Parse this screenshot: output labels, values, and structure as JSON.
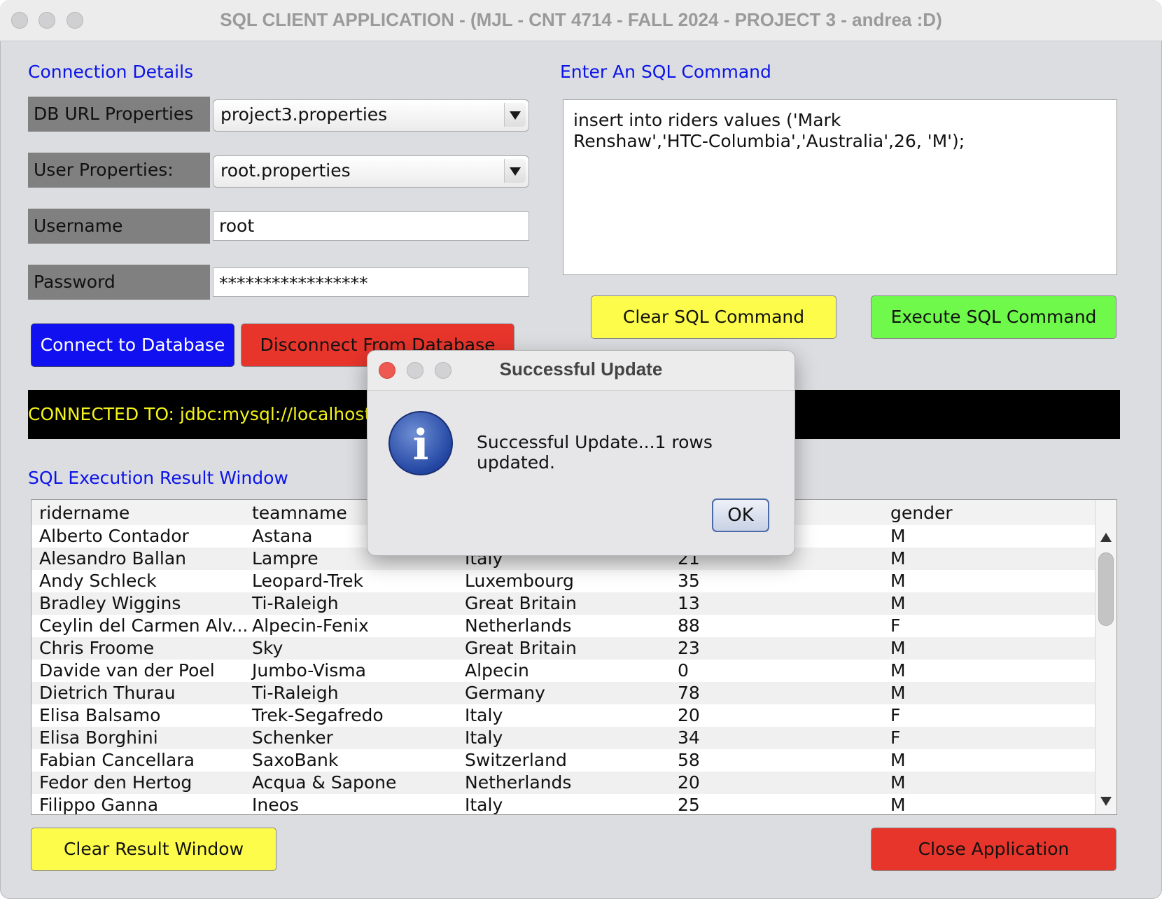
{
  "window": {
    "title": "SQL CLIENT APPLICATION - (MJL - CNT 4714 - FALL 2024 - PROJECT 3 - andrea :D)"
  },
  "connection": {
    "section_label": "Connection Details",
    "db_url_label": "DB URL Properties",
    "db_url_value": "project3.properties",
    "user_props_label": "User Properties:",
    "user_props_value": "root.properties",
    "username_label": "Username",
    "username_value": "root",
    "password_label": "Password",
    "password_value": "*****************",
    "connect_button": "Connect to Database",
    "disconnect_button": "Disconnect From Database",
    "status_text": "CONNECTED TO: jdbc:mysql://localhost:3"
  },
  "sql": {
    "section_label": "Enter An SQL Command",
    "command_text": "insert into riders values ('Mark\nRenshaw','HTC-Columbia','Australia',26, 'M');",
    "clear_button": "Clear SQL Command",
    "execute_button": "Execute SQL Command"
  },
  "results": {
    "section_label": "SQL Execution Result Window",
    "columns": [
      "ridername",
      "teamname",
      "",
      "",
      "gender"
    ],
    "rows": [
      [
        "Alberto Contador",
        "Astana",
        "",
        "",
        "M"
      ],
      [
        "Alesandro Ballan",
        "Lampre",
        "Italy",
        "21",
        "M"
      ],
      [
        "Andy Schleck",
        "Leopard-Trek",
        "Luxembourg",
        "35",
        "M"
      ],
      [
        "Bradley Wiggins",
        "Ti-Raleigh",
        "Great Britain",
        "13",
        "M"
      ],
      [
        "Ceylin del Carmen Alv...",
        "Alpecin-Fenix",
        "Netherlands",
        "88",
        "F"
      ],
      [
        "Chris Froome",
        "Sky",
        "Great Britain",
        "23",
        "M"
      ],
      [
        "Davide van der Poel",
        "Jumbo-Visma",
        "Alpecin",
        "0",
        "M"
      ],
      [
        "Dietrich Thurau",
        "Ti-Raleigh",
        "Germany",
        "78",
        "M"
      ],
      [
        "Elisa Balsamo",
        "Trek-Segafredo",
        "Italy",
        "20",
        "F"
      ],
      [
        "Elisa Borghini",
        "Schenker",
        "Italy",
        "34",
        "F"
      ],
      [
        "Fabian Cancellara",
        "SaxoBank",
        "Switzerland",
        "58",
        "M"
      ],
      [
        "Fedor den Hertog",
        "Acqua & Sapone",
        "Netherlands",
        "20",
        "M"
      ],
      [
        "Filippo Ganna",
        "Ineos",
        "Italy",
        "25",
        "M"
      ]
    ],
    "clear_button": "Clear Result Window",
    "close_button": "Close Application"
  },
  "dialog": {
    "title": "Successful Update",
    "message": "Successful Update...1 rows updated.",
    "ok_button": "OK",
    "icon": "info-icon"
  },
  "colors": {
    "section_label": "#0b14e8",
    "connect": "#1010f0",
    "disconnect": "#e8352b",
    "clear_sql": "#fdfc4b",
    "execute_sql": "#6ef94b",
    "clear_results": "#fdfc4b",
    "close_app": "#e8352b",
    "status_text": "#f4f31a"
  }
}
